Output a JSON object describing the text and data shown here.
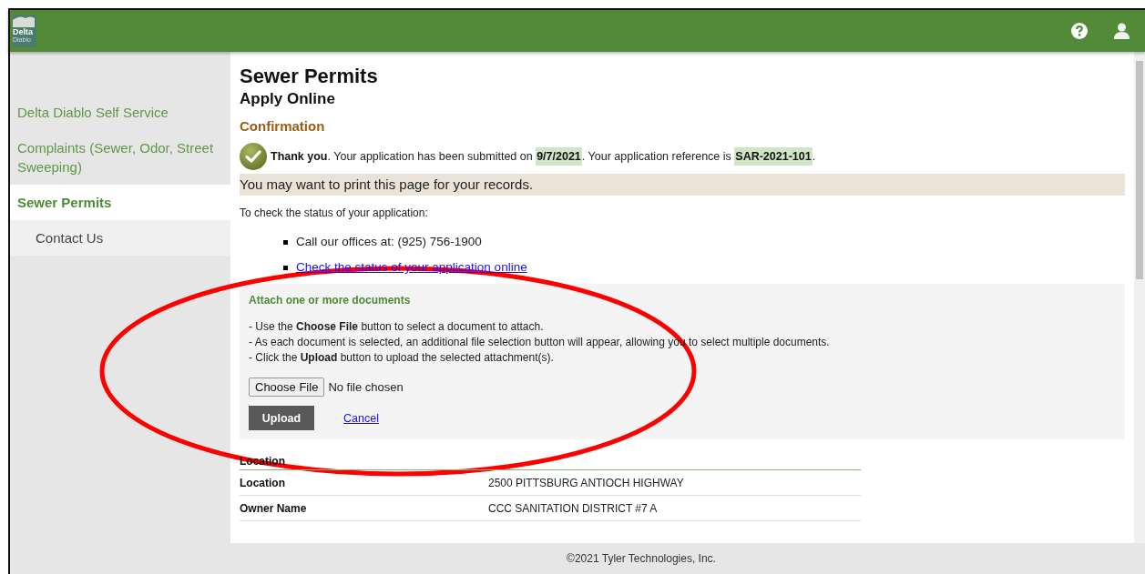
{
  "header": {
    "logo": {
      "line_1": "Delta",
      "line_2": "Diablo"
    }
  },
  "sidebar": {
    "items": [
      {
        "label": "Delta Diablo Self Service",
        "selected": false
      },
      {
        "label": "Complaints (Sewer, Odor, Street Sweeping)",
        "selected": false
      },
      {
        "label": "Sewer Permits",
        "selected": true,
        "children": [
          {
            "label": "Contact Us",
            "selected": false
          }
        ]
      }
    ]
  },
  "page": {
    "title": "Sewer Permits",
    "subtitle": "Apply Online",
    "section": "Confirmation",
    "message": [
      {
        "kind": "bold",
        "text": "Thank you"
      },
      {
        "kind": "plain",
        "text": ". Your application has been submitted on "
      },
      {
        "kind": "highlight",
        "text": "9/7/2021"
      },
      {
        "kind": "plain",
        "text": ". Your application reference is "
      },
      {
        "kind": "highlight",
        "text": "SAR-2021-101"
      },
      {
        "kind": "plain",
        "text": "."
      }
    ],
    "print_notice": "You may want to print this page for your records.",
    "status_intro": "To check the status of your application:",
    "status_options": [
      {
        "kind": "text",
        "text": "Call our offices at: (925) 756-1900"
      },
      {
        "kind": "link",
        "text": "Check the status of your application online"
      }
    ]
  },
  "attachments": {
    "title": "Attach one or more documents",
    "instructions": [
      "- Use the **Choose File** button to select a document to attach.",
      "- As each document is selected, an additional file selection button will appear, allowing you to select multiple documents.",
      "- Click the **Upload** button to upload the selected attachment(s)."
    ],
    "choose_button": "Choose File",
    "file_status": "No file chosen",
    "upload_button": "Upload",
    "cancel_link": "Cancel"
  },
  "table": {
    "heading": "Location",
    "rows": [
      {
        "label": "Location",
        "value": "2500 PITTSBURG ANTIOCH HIGHWAY"
      },
      {
        "label": "Owner Name",
        "value": "CCC SANITATION DISTRICT #7 A"
      }
    ]
  },
  "footer": {
    "text": "©2021 Tyler Technologies, Inc."
  }
}
